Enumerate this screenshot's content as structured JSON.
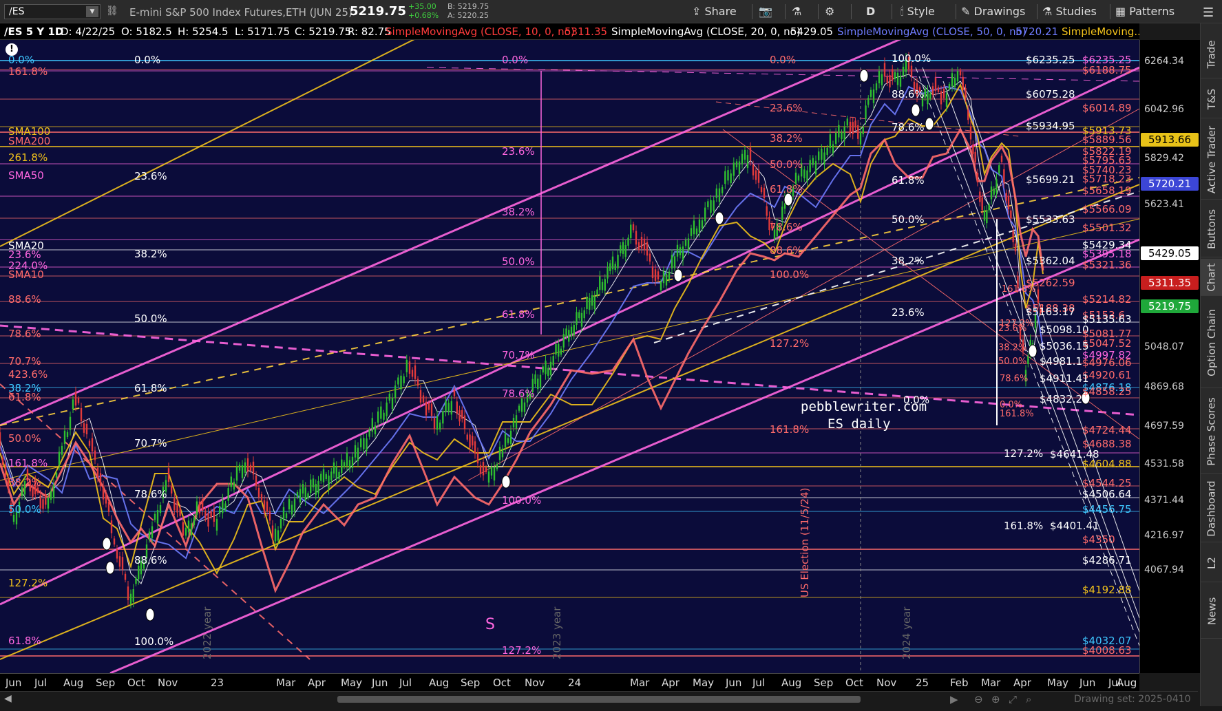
{
  "toolbar": {
    "symbol": "/ES",
    "instrument": "E-mini S&P 500 Index Futures,ETH (JUN 25)",
    "last": "5219.75",
    "change": "+35.00",
    "change_pct": "+0.68%",
    "bid": "B: 5219.75",
    "ask": "A: 5220.25",
    "share": "Share",
    "aggregation": "D",
    "style": "Style",
    "drawings": "Drawings",
    "studies": "Studies",
    "patterns": "Patterns"
  },
  "header": {
    "symbol_period": "/ES 5 Y 1D",
    "date": "D: 4/22/25",
    "open": "O: 5182.5",
    "high": "H: 5254.5",
    "low": "L: 5171.75",
    "close": "C: 5219.75",
    "range": "R: 82.75",
    "sma10_label": "SimpleMovingAvg (CLOSE, 10, 0, no)",
    "sma10_value": "5311.35",
    "sma20_label": "SimpleMovingAvg (CLOSE, 20, 0, no)",
    "sma20_value": "5429.05",
    "sma50_label": "SimpleMovingAvg (CLOSE, 50, 0, no)",
    "sma50_value": "5720.21",
    "sma_more": "SimpleMoving..."
  },
  "colors": {
    "chart_bg": "#0b0c3a",
    "up": "#2fbf2f",
    "down": "#e23a3a",
    "channel": "#ff66e0",
    "fib": "#ff6b6b",
    "sma": "#f2c21b",
    "tag_green": "#1fa83a",
    "tag_red": "#c81e1e",
    "tag_blue": "#3c46d6",
    "tag_yellow": "#e8c218"
  },
  "price_axis": [
    "6264.34",
    "6042.96",
    "5829.42",
    "5623.41",
    "5048.07",
    "4869.68",
    "4697.59",
    "4531.58",
    "4371.44",
    "4216.97",
    "4067.94"
  ],
  "price_tags": [
    {
      "value": "5913.66"
    },
    {
      "value": "5720.21"
    },
    {
      "value": "5429.05"
    },
    {
      "value": "5311.35"
    },
    {
      "value": "5219.75"
    }
  ],
  "time_axis": [
    "Jun",
    "Jul",
    "Aug",
    "Sep",
    "Oct",
    "Nov",
    "23",
    "Mar",
    "Apr",
    "May",
    "Jun",
    "Jul",
    "Aug",
    "Sep",
    "Oct",
    "Nov",
    "24",
    "Mar",
    "Apr",
    "May",
    "Jun",
    "Jul",
    "Aug",
    "Sep",
    "Oct",
    "Nov",
    "25",
    "Feb",
    "Mar",
    "Apr",
    "May",
    "Jun",
    "Jul",
    "Aug"
  ],
  "labels_left": {
    "p0": "0.0%",
    "p1618": "161.8%",
    "sma100": "SMA100",
    "sma200": "SMA200",
    "p2618": "261.8%",
    "sma50": "SMA50",
    "sma20": "SMA20",
    "p236": "23.6%",
    "p224": "224.0%",
    "sma10": "SMA10",
    "p886": "88.6%",
    "p786": "78.6%",
    "p707": "70.7%",
    "p4236": "423.6%",
    "p382": "38.2%",
    "p618": "61.8%",
    "p500": "50.0%",
    "p1618b": "161.8%",
    "p382b": "38.2%",
    "p500b": "50.0%",
    "p1272": "127.2%",
    "p618b": "61.8%"
  },
  "fib_mid": {
    "a0": "0.0%",
    "a236": "23.6%",
    "a382": "38.2%",
    "a500": "50.0%",
    "a618": "61.8%",
    "a707": "70.7%",
    "a786": "78.6%",
    "a886": "88.6%",
    "a1000": "100.0%"
  },
  "fib_center": {
    "b0": "0.0%",
    "b236": "23.6%",
    "b382": "38.2%",
    "b500": "50.0%",
    "b618": "61.8%",
    "b707": "70.7%",
    "b786": "78.6%",
    "b1000": "100.0%",
    "b1272": "127.2%"
  },
  "fib_right": {
    "c0": "0.0%",
    "c236": "23.6%",
    "c382": "38.2%",
    "c500": "50.0%",
    "c618": "61.8%",
    "c786": "78.6%",
    "c886": "88.6%",
    "c1000": "100.0%",
    "c1272": "127.2%",
    "c1618": "161.8%",
    "c236b": "23.6%",
    "c382b": "38.2%",
    "c500b": "50.0%",
    "c786b": "78.6%",
    "c0b": "0.0%",
    "c1618b": "161.8%",
    "c1272b": "127.2%",
    "c1618c": "161.8%"
  },
  "fib_far": {
    "f100": "100.0%",
    "f886": "88.6%",
    "f786": "78.6%",
    "f618": "61.8%",
    "f500": "50.0%",
    "f382": "38.2%",
    "f236": "23.6%",
    "f0": "0.0%",
    "f1272": "127.2%",
    "f1618": "161.8%"
  },
  "price_levels": {
    "l6235": "$6235.25",
    "l6235b": "$6235.25",
    "l6188": "$6188.75",
    "l6075": "$6075.28",
    "l6014": "$6014.89",
    "l5934": "$5934.95",
    "l5913": "$5913.73",
    "l5889": "$5889.56",
    "l5822": "$5822.19",
    "l5795": "$5795.63",
    "l5740": "$5740.23",
    "l5718": "$5718.23",
    "l5699": "$5699.21",
    "l5658": "$5658.19",
    "l5566": "$5566.09",
    "l5533": "$5533.63",
    "l5501": "$5501.32",
    "l5429": "$5429.34",
    "l5395": "$5395.18",
    "l5362": "$5362.04",
    "l5321": "$5321.36",
    "l5262": "$5262.59",
    "l5214": "$5214.82",
    "l5188": "$5188.38",
    "l5163": "$5163.17",
    "l5153": "$5153.6",
    "l5135": "$5135.63",
    "l5098": "$5098.10",
    "l5081": "$5081.77",
    "l5047": "$5047.52",
    "l5036": "$5036.15",
    "l4997": "$4997.82",
    "l4981": "$4981.1",
    "l4976": "$4976.06",
    "l4920": "$4920.61",
    "l4911": "$4911.41",
    "l4876": "$4876.18",
    "l4858": "$4858.25",
    "l4832": "$4832.2",
    "l4724": "$4724.44",
    "l4688": "$4688.38",
    "l4641": "$4641.48",
    "l4604": "$4604.88",
    "l4544": "$4544.25",
    "l4506": "$4506.64",
    "l4456": "$4456.75",
    "l4401": "$4401.41",
    "l4350": "$4350",
    "l4286": "$4286.71",
    "l4192": "$4192.88",
    "l4032": "$4032.07",
    "l4008": "$4008.63"
  },
  "annotations": {
    "watermark": "pebblewriter.com",
    "subtitle": "ES daily",
    "election": "US Election (11/5/24)",
    "y2023": "2023 year",
    "y2024": "2024 year",
    "y2022": "2022 year",
    "s_mark": "S"
  },
  "bottom": {
    "drawing_set": "Drawing set: 2025-0410"
  },
  "side_tabs": [
    "Trade",
    "T&S",
    "Active Trader",
    "Buttons",
    "Chart",
    "Option Chain",
    "Phase Scores",
    "Dashboard",
    "L2",
    "News"
  ]
}
